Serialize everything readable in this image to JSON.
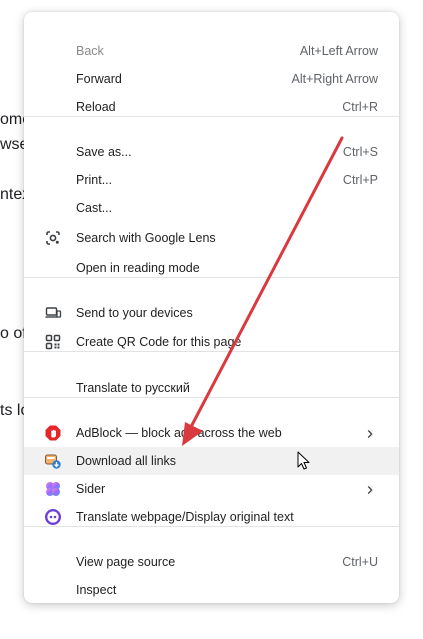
{
  "background_fragments": [
    "ome",
    "wse",
    "ntex",
    "o of",
    "ts lo"
  ],
  "menu": {
    "groups": [
      [
        {
          "label": "Back",
          "shortcut": "Alt+Left Arrow",
          "disabled": true
        },
        {
          "label": "Forward",
          "shortcut": "Alt+Right Arrow"
        },
        {
          "label": "Reload",
          "shortcut": "Ctrl+R"
        }
      ],
      [
        {
          "label": "Save as...",
          "shortcut": "Ctrl+S"
        },
        {
          "label": "Print...",
          "shortcut": "Ctrl+P"
        },
        {
          "label": "Cast..."
        },
        {
          "label": "Search with Google Lens",
          "icon": "google-lens-icon"
        },
        {
          "label": "Open in reading mode"
        }
      ],
      [
        {
          "label": "Send to your devices",
          "icon": "devices-icon"
        },
        {
          "label": "Create QR Code for this page",
          "icon": "qr-code-icon"
        }
      ],
      [
        {
          "label": "Translate to русский"
        }
      ],
      [
        {
          "label": "AdBlock — block ads across the web",
          "icon": "adblock-icon",
          "submenu": true
        },
        {
          "label": "Download all links",
          "icon": "download-links-icon",
          "hovered": true
        },
        {
          "label": "Sider",
          "icon": "sider-icon",
          "submenu": true
        },
        {
          "label": "Translate webpage/Display original text",
          "icon": "translate-extension-icon"
        }
      ],
      [
        {
          "label": "View page source",
          "shortcut": "Ctrl+U"
        },
        {
          "label": "Inspect"
        }
      ]
    ]
  },
  "annotation": {
    "arrow_color": "#d9393f"
  }
}
